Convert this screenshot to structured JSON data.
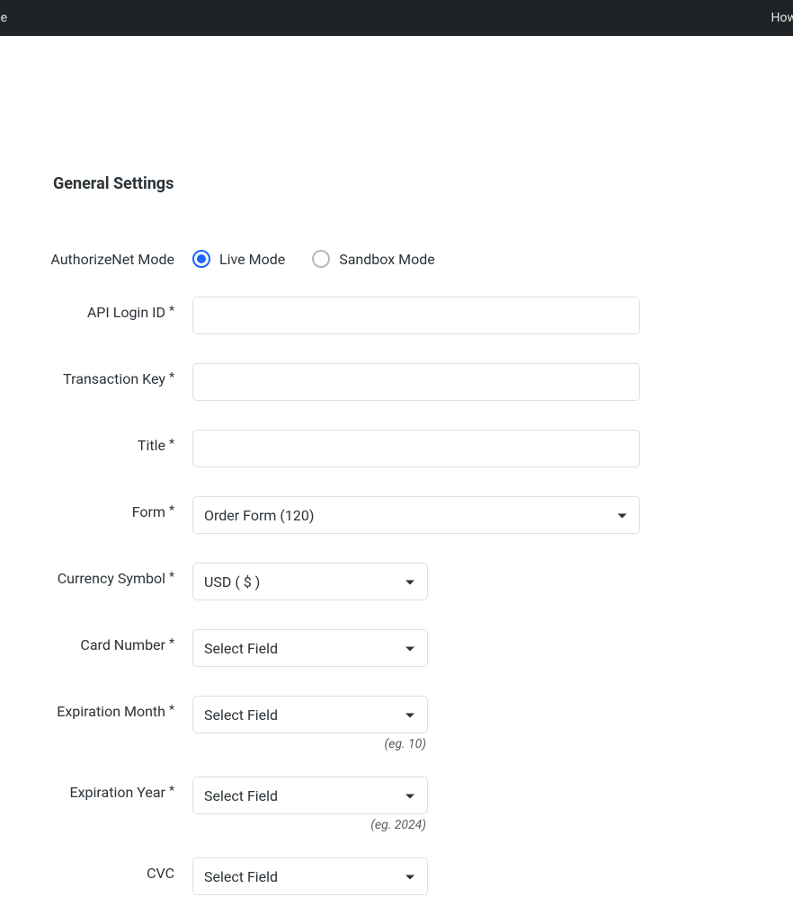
{
  "topbar": {
    "left_fragment": "te",
    "right_fragment": "How"
  },
  "section_title": "General Settings",
  "fields": {
    "mode": {
      "label": "AuthorizeNet Mode",
      "options": {
        "live": "Live Mode",
        "sandbox": "Sandbox Mode"
      },
      "selected": "live"
    },
    "api_login_id": {
      "label": "API Login ID",
      "required": "*",
      "value": ""
    },
    "transaction_key": {
      "label": "Transaction Key",
      "required": "*",
      "value": ""
    },
    "title": {
      "label": "Title",
      "required": "*",
      "value": ""
    },
    "form": {
      "label": "Form",
      "required": "*",
      "value": "Order Form (120)"
    },
    "currency_symbol": {
      "label": "Currency Symbol",
      "required": "*",
      "value": "USD ( $ )"
    },
    "card_number": {
      "label": "Card Number",
      "required": "*",
      "value": "Select Field"
    },
    "expiration_month": {
      "label": "Expiration Month",
      "required": "*",
      "value": "Select Field",
      "hint": "(eg. 10)"
    },
    "expiration_year": {
      "label": "Expiration Year",
      "required": "*",
      "value": "Select Field",
      "hint": "(eg. 2024)"
    },
    "cvc": {
      "label": "CVC",
      "value": "Select Field"
    }
  }
}
